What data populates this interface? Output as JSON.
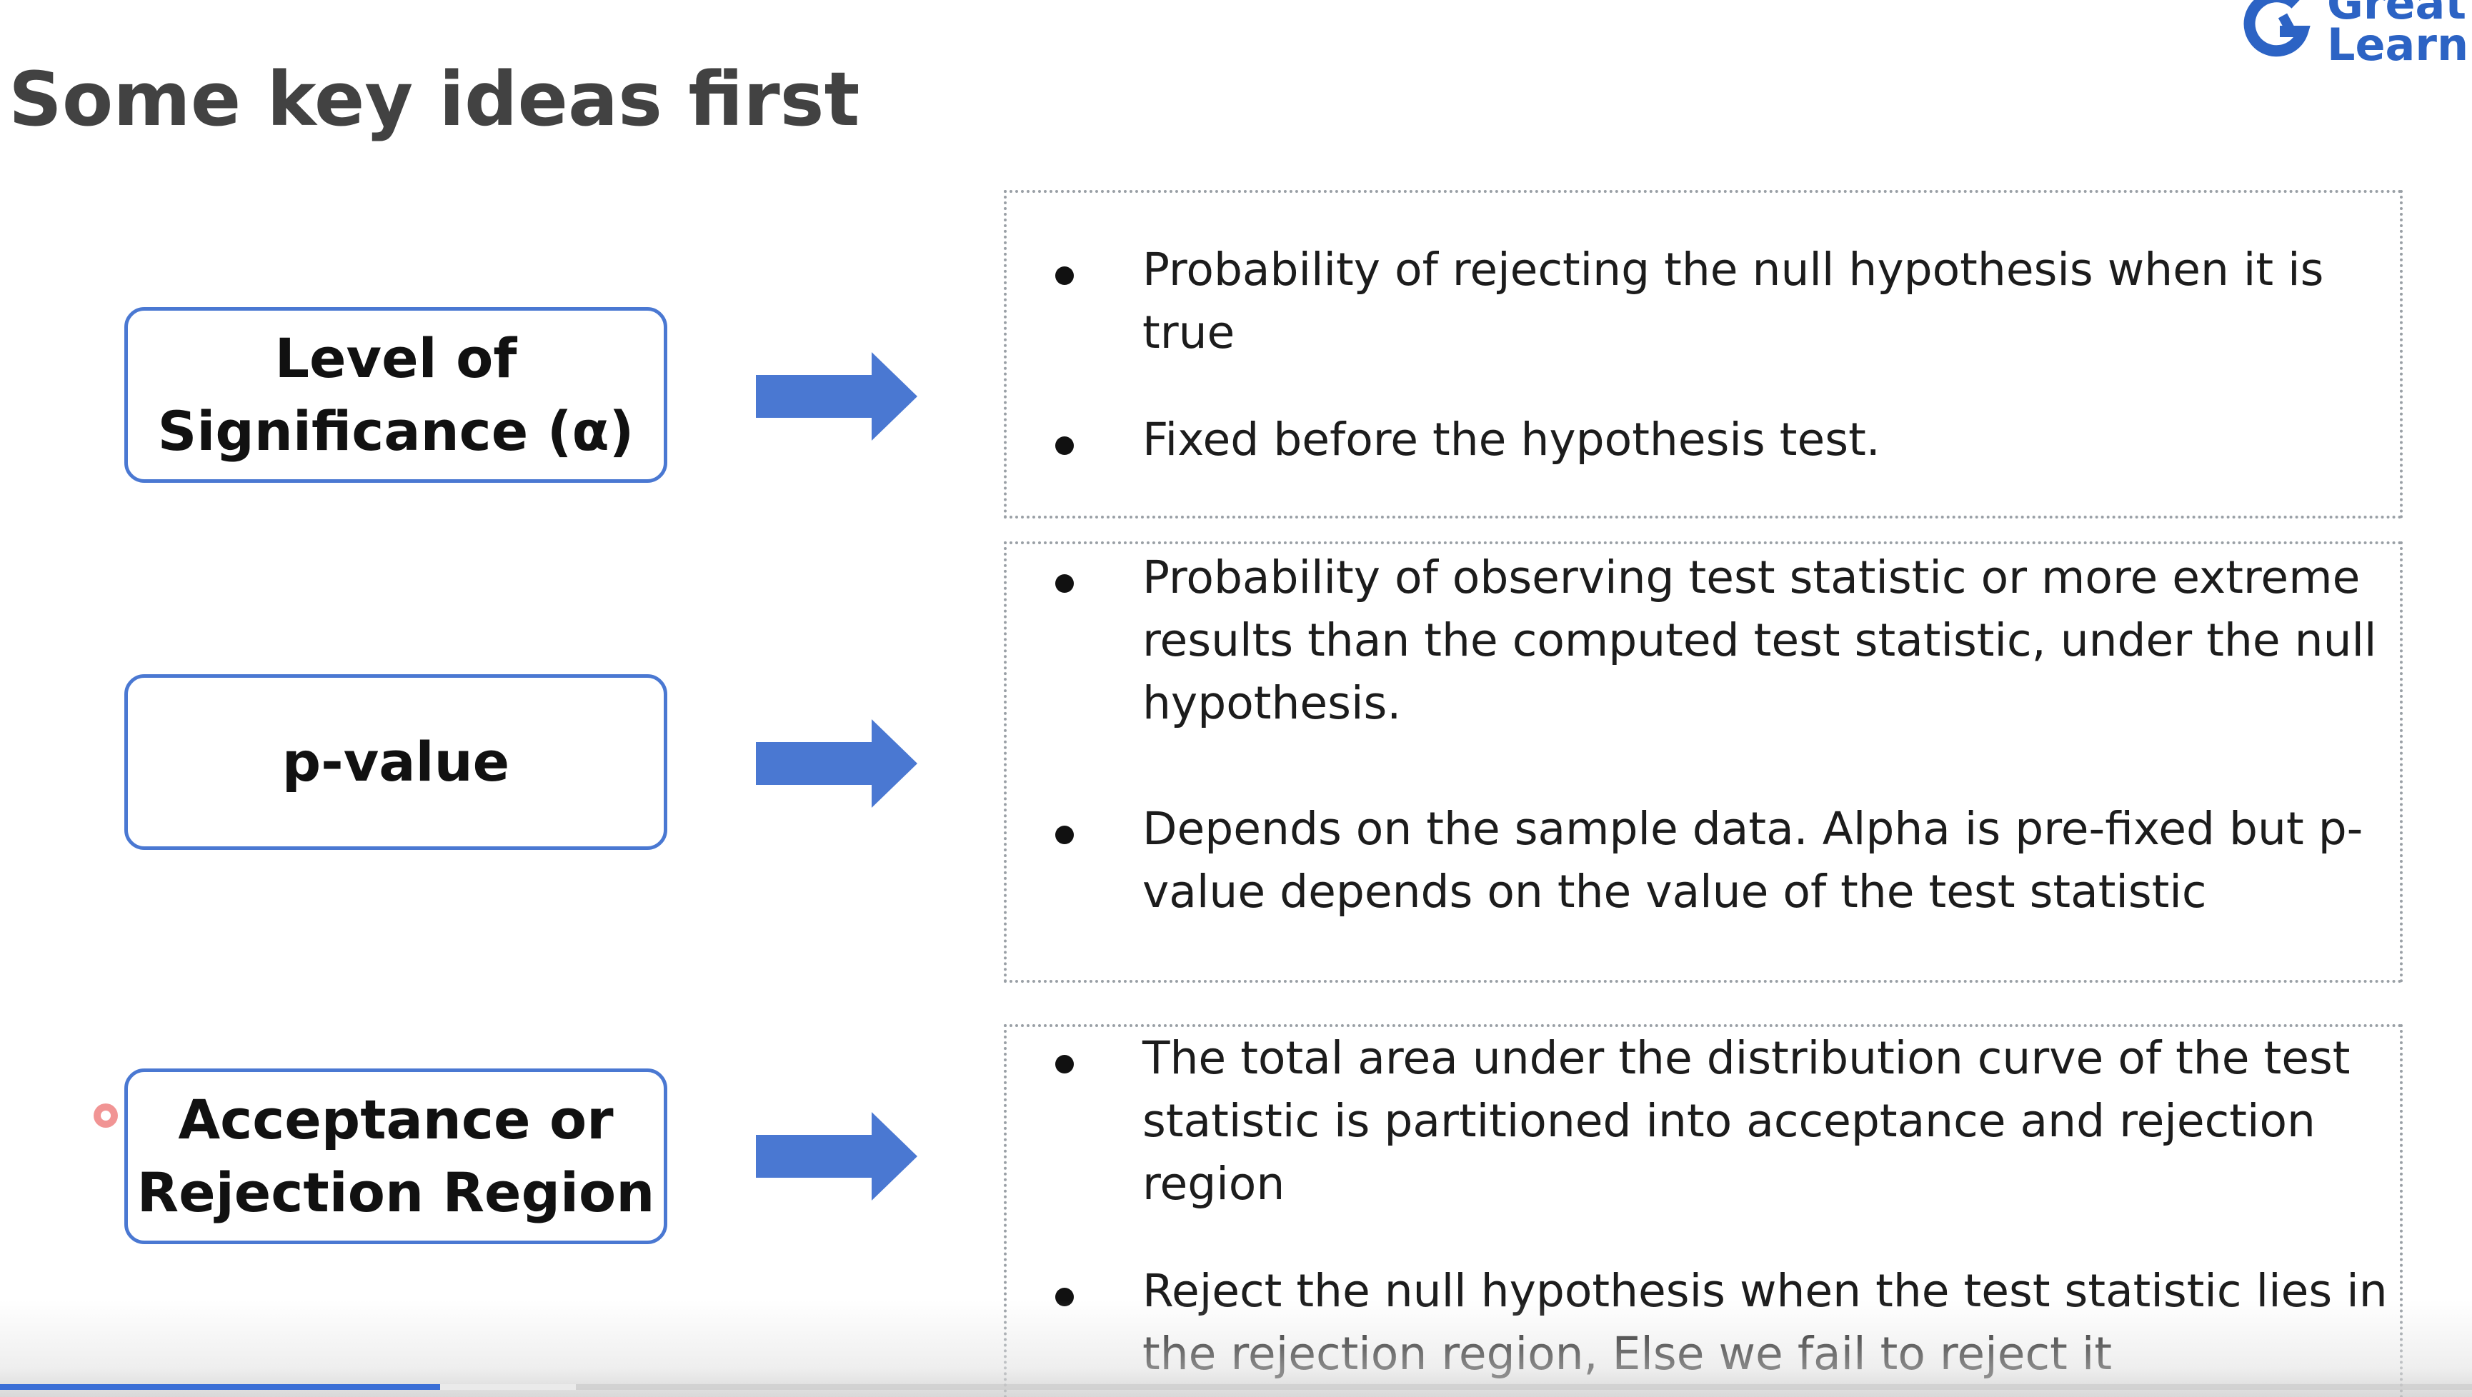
{
  "slide": {
    "title": "Some key ideas first",
    "logo": {
      "line1": "Great",
      "line2": "Learn",
      "color": "#2c63c4"
    },
    "accent_color": "#4a78d2",
    "concepts": [
      {
        "label": "Level of\nSignificance (α)",
        "bullets": [
          "Probability of rejecting the null hypothesis when it is true",
          "Fixed before the hypothesis test."
        ]
      },
      {
        "label": "p-value",
        "bullets": [
          "Probability of observing test statistic or more extreme results than the computed test statistic, under the null hypothesis.",
          "Depends on the sample data. Alpha is pre-fixed but p-value depends on the value of the test statistic"
        ]
      },
      {
        "label": "Acceptance or\nRejection Region",
        "bullets": [
          "The total area under the distribution curve of the test statistic is partitioned into acceptance and rejection region",
          "Reject the null hypothesis when the test statistic lies in the rejection region, Else we fail to reject it"
        ]
      }
    ]
  },
  "player": {
    "progress_played": 0.178,
    "progress_buffered": 0.233,
    "played_color": "#3b6fd6"
  }
}
